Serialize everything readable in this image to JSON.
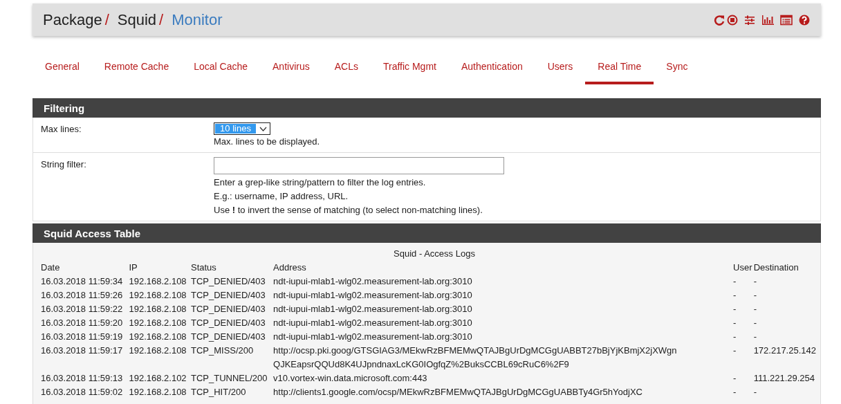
{
  "breadcrumb": [
    {
      "label": "Package",
      "kind": "crumb",
      "separator": "/"
    },
    {
      "label": "Squid",
      "kind": "crumb",
      "separator": "/"
    },
    {
      "label": "Monitor",
      "kind": "current"
    }
  ],
  "header_icons": [
    {
      "kind": "refresh"
    },
    {
      "kind": "stop"
    },
    {
      "kind": "sliders"
    },
    {
      "kind": "chart"
    },
    {
      "kind": "log"
    },
    {
      "kind": "help"
    }
  ],
  "tabs": [
    {
      "label": "General",
      "selected": false
    },
    {
      "label": "Remote Cache",
      "selected": false
    },
    {
      "label": "Local Cache",
      "selected": false
    },
    {
      "label": "Antivirus",
      "selected": false
    },
    {
      "label": "ACLs",
      "selected": false
    },
    {
      "label": "Traffic Mgmt",
      "selected": false
    },
    {
      "label": "Authentication",
      "selected": false
    },
    {
      "label": "Users",
      "selected": false
    },
    {
      "label": "Real Time",
      "selected": true
    },
    {
      "label": "Sync",
      "selected": false
    }
  ],
  "filtering": {
    "title": "Filtering",
    "rows": [
      {
        "kind": "select",
        "label": "Max lines:",
        "value": "10 lines",
        "help": [
          "Max. lines to be displayed."
        ]
      },
      {
        "kind": "text",
        "label": "String filter:",
        "help": [
          "Enter a grep-like string/pattern to filter the log entries.",
          "E.g.: username, IP address, URL.",
          "Use **!** to invert the sense of matching (to select non-matching lines)."
        ]
      }
    ]
  },
  "access_table": {
    "title": "Squid Access Table",
    "caption": "Squid - Access Logs",
    "columns": [
      "Date",
      "IP",
      "Status",
      "Address",
      "User",
      "Destination"
    ],
    "rows": [
      [
        "16.03.2018 11:59:34",
        "192.168.2.108",
        "TCP_DENIED/403",
        "ndt-iupui-mlab1-wlg02.measurement-lab.org:3010",
        "-",
        "-"
      ],
      [
        "16.03.2018 11:59:26",
        "192.168.2.108",
        "TCP_DENIED/403",
        "ndt-iupui-mlab1-wlg02.measurement-lab.org:3010",
        "-",
        "-"
      ],
      [
        "16.03.2018 11:59:22",
        "192.168.2.108",
        "TCP_DENIED/403",
        "ndt-iupui-mlab1-wlg02.measurement-lab.org:3010",
        "-",
        "-"
      ],
      [
        "16.03.2018 11:59:20",
        "192.168.2.108",
        "TCP_DENIED/403",
        "ndt-iupui-mlab1-wlg02.measurement-lab.org:3010",
        "-",
        "-"
      ],
      [
        "16.03.2018 11:59:19",
        "192.168.2.108",
        "TCP_DENIED/403",
        "ndt-iupui-mlab1-wlg02.measurement-lab.org:3010",
        "-",
        "-"
      ],
      [
        "16.03.2018 11:59:17",
        "192.168.2.108",
        "TCP_MISS/200",
        "http://ocsp.pki.goog/GTSGIAG3/MEkwRzBFMEMwQTAJBgUrDgMCGgUABBT27bBjYjKBmjX2jXWgnQJKEapsrQQUd8K4UJpndnaxLcKG0IOgfqZ%2BuksCCBL69cRuC6%2F9",
        "-",
        "172.217.25.142"
      ],
      [
        "16.03.2018 11:59:13",
        "192.168.2.102",
        "TCP_TUNNEL/200",
        "v10.vortex-win.data.microsoft.com:443",
        "-",
        "111.221.29.254"
      ],
      [
        "16.03.2018 11:59:02",
        "192.168.2.108",
        "TCP_HIT/200",
        "http://clients1.google.com/ocsp/MEkwRzBFMEMwQTAJBgUrDgMCGgUABBTy4Gr5hYodjXC",
        "-",
        "-"
      ]
    ]
  }
}
